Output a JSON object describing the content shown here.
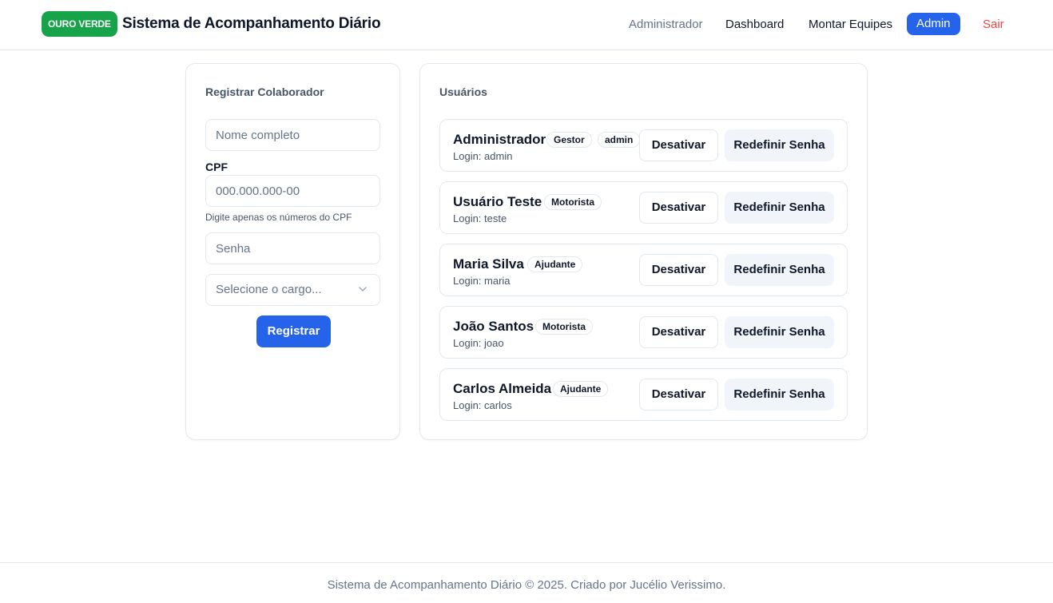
{
  "header": {
    "brand": "OURO VERDE",
    "title": "Sistema de Acompanhamento Diário",
    "user": "Administrador",
    "nav": {
      "dashboard": "Dashboard",
      "teams": "Montar Equipes",
      "admin": "Admin",
      "logout": "Sair"
    }
  },
  "register": {
    "title": "Registrar Colaborador",
    "name_placeholder": "Nome completo",
    "cpf_label": "CPF",
    "cpf_placeholder": "000.000.000-00",
    "cpf_hint": "Digite apenas os números do CPF",
    "password_placeholder": "Senha",
    "role_placeholder": "Selecione o cargo...",
    "submit": "Registrar"
  },
  "users": {
    "title": "Usuários",
    "deactivate_label": "Desativar",
    "reset_label": "Redefinir Senha",
    "items": [
      {
        "name": "Administrador",
        "login": "Login: admin",
        "badges": [
          "Gestor",
          "admin"
        ]
      },
      {
        "name": "Usuário Teste",
        "login": "Login: teste",
        "badges": [
          "Motorista"
        ]
      },
      {
        "name": "Maria Silva",
        "login": "Login: maria",
        "badges": [
          "Ajudante"
        ]
      },
      {
        "name": "João Santos",
        "login": "Login: joao",
        "badges": [
          "Motorista"
        ]
      },
      {
        "name": "Carlos Almeida",
        "login": "Login: carlos",
        "badges": [
          "Ajudante"
        ]
      }
    ]
  },
  "footer": {
    "text": "Sistema de Acompanhamento Diário © 2025. Criado por Jucélio Verissimo."
  },
  "colors": {
    "brand_green": "#16a34a",
    "primary_blue": "#2563eb",
    "danger_red": "#ef4444"
  }
}
